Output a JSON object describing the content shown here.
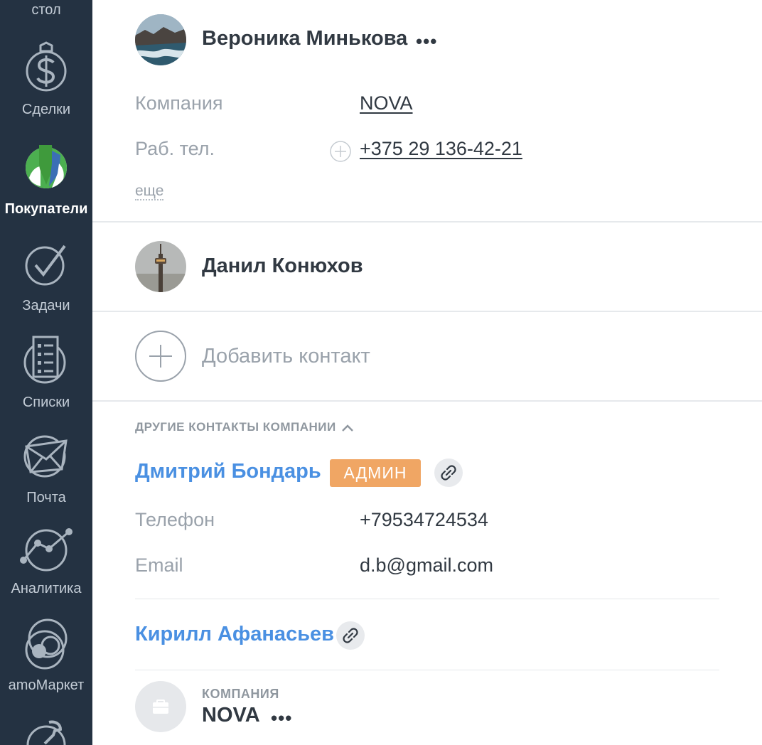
{
  "sidebar": {
    "items": [
      {
        "label": "стол",
        "icon": "desktop-icon"
      },
      {
        "label": "Сделки",
        "icon": "dollar-icon"
      },
      {
        "label": "Покупатели",
        "icon": "customers-icon",
        "active": true
      },
      {
        "label": "Задачи",
        "icon": "check-icon"
      },
      {
        "label": "Списки",
        "icon": "list-icon"
      },
      {
        "label": "Почта",
        "icon": "mail-icon"
      },
      {
        "label": "Аналитика",
        "icon": "analytics-icon"
      },
      {
        "label": "amoМаркет",
        "icon": "market-icon"
      },
      {
        "label": "",
        "icon": "wrench-icon"
      }
    ]
  },
  "contacts": [
    {
      "name": "Вероника Минькова",
      "menu": "•••",
      "fields": [
        {
          "label": "Компания",
          "value": "NOVA"
        },
        {
          "label": "Раб. тел.",
          "value": "+375 29 136-42-21"
        }
      ],
      "more": "еще"
    },
    {
      "name": "Данил Конюхов"
    }
  ],
  "add_contact": "Добавить контакт",
  "other_contacts": {
    "title": "ДРУГИЕ КОНТАКТЫ КОМПАНИИ",
    "items": [
      {
        "name": "Дмитрий Бондарь",
        "badge": "АДМИН",
        "fields": [
          {
            "label": "Телефон",
            "value": "+79534724534"
          },
          {
            "label": "Email",
            "value": "d.b@gmail.com"
          }
        ]
      },
      {
        "name": "Кирилл Афанасьев"
      }
    ]
  },
  "company": {
    "caption": "КОМПАНИЯ",
    "name": "NOVA",
    "menu": "•••"
  },
  "colors": {
    "sidebar_bg": "#243242",
    "link_blue": "#4a90e2",
    "badge_orange": "#f0a664",
    "active_icon_green": "#4caf50"
  }
}
